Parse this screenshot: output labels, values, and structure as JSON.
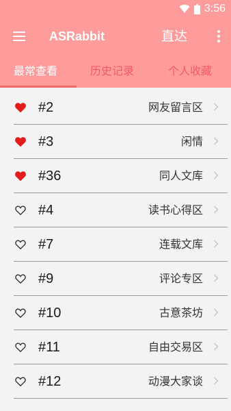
{
  "status": {
    "time": "3:56",
    "icons": [
      "wifi-icon",
      "battery-icon"
    ]
  },
  "appbar": {
    "title": "ASRabbit",
    "direct_label": "直达",
    "icons": [
      "menu-icon",
      "more-vert-icon"
    ]
  },
  "tabs": [
    {
      "label": "最常查看",
      "active": true
    },
    {
      "label": "历史记录",
      "active": false
    },
    {
      "label": "个人收藏",
      "active": false
    }
  ],
  "colors": {
    "bar": "#fe9b9b",
    "accent": "#f26a6a",
    "heart_filled": "#e41b1b",
    "background": "#f3f3f3"
  },
  "boards": [
    {
      "number": "#2",
      "name": "网友留言区",
      "favorite": true
    },
    {
      "number": "#3",
      "name": "闲情",
      "favorite": true
    },
    {
      "number": "#36",
      "name": "同人文库",
      "favorite": true
    },
    {
      "number": "#4",
      "name": "读书心得区",
      "favorite": false
    },
    {
      "number": "#7",
      "name": "连载文库",
      "favorite": false
    },
    {
      "number": "#9",
      "name": "评论专区",
      "favorite": false
    },
    {
      "number": "#10",
      "name": "古意茶坊",
      "favorite": false
    },
    {
      "number": "#11",
      "name": "自由交易区",
      "favorite": false
    },
    {
      "number": "#12",
      "name": "动漫大家谈",
      "favorite": false
    }
  ]
}
